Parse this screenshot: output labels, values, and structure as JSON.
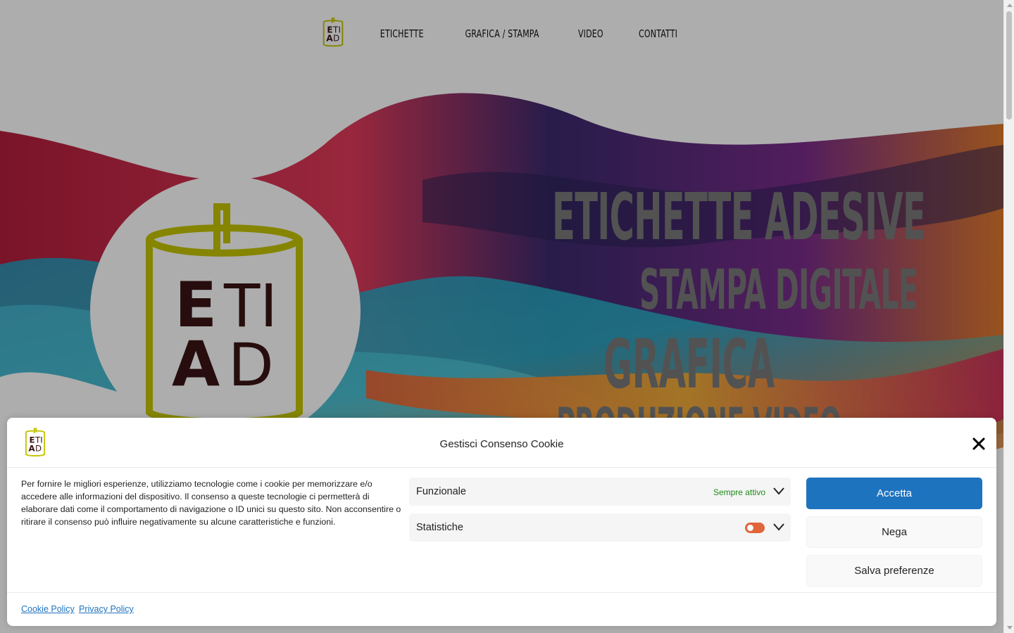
{
  "nav": {
    "links": [
      "ETICHETTE",
      "GRAFICA / STAMPA",
      "VIDEO",
      "CONTATTI"
    ]
  },
  "logo": {
    "line1": "ETI",
    "line2": "AD"
  },
  "hero": {
    "line1": "ETICHETTE ADESIVE",
    "line2": "STAMPA DIGITALE",
    "line3": "GRAFICA",
    "line4": "PRODUZIONE VIDEO"
  },
  "cookie_banner": {
    "title": "Gestisci Consenso Cookie",
    "description": "Per fornire le migliori esperienze, utilizziamo tecnologie come i cookie per memorizzare e/o accedere alle informazioni del dispositivo. Il consenso a queste tecnologie ci permetterà di elaborare dati come il comportamento di navigazione o ID unici su questo sito. Non acconsentire o ritirare il consenso può influire negativamente su alcune caratteristiche e funzioni.",
    "categories": [
      {
        "label": "Funzionale",
        "status": "Sempre attivo"
      },
      {
        "label": "Statistiche",
        "toggle": "off"
      }
    ],
    "buttons": {
      "accept": "Accetta",
      "deny": "Nega",
      "save": "Salva preferenze"
    },
    "links": {
      "cookie_policy": "Cookie Policy",
      "privacy_policy": "Privacy Policy"
    }
  },
  "colors": {
    "accent": "#1e73be",
    "always_active": "#1e8a16",
    "toggle": "#e0653a",
    "logo_frame": "#c4c400",
    "logo_text": "#3a1414"
  },
  "icons": [
    "close-icon",
    "chevron-down-icon",
    "logo-icon"
  ]
}
